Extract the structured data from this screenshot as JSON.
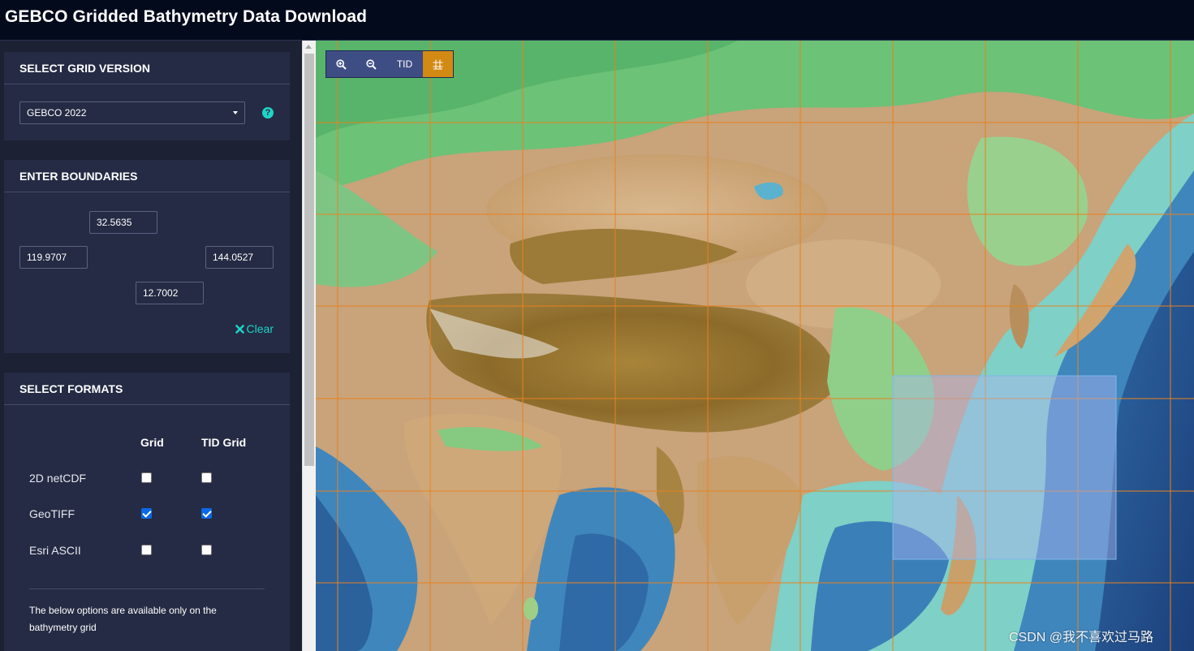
{
  "header": {
    "title": "GEBCO Gridded Bathymetry Data Download"
  },
  "grid_version": {
    "heading": "SELECT GRID VERSION",
    "selected": "GEBCO 2022",
    "help": "?"
  },
  "boundaries": {
    "heading": "ENTER BOUNDARIES",
    "north": "32.5635",
    "west": "119.9707",
    "east": "144.0527",
    "south": "12.7002",
    "clear_label": "Clear"
  },
  "formats": {
    "heading": "SELECT FORMATS",
    "col_grid": "Grid",
    "col_tid": "TID Grid",
    "rows": [
      {
        "label": "2D netCDF",
        "grid": false,
        "tid": false
      },
      {
        "label": "GeoTIFF",
        "grid": true,
        "tid": true
      },
      {
        "label": "Esri ASCII",
        "grid": false,
        "tid": false
      }
    ],
    "note": "The below options are available only on the bathymetry grid"
  },
  "map": {
    "toolbar": {
      "zoom_in": "zoom-in-icon",
      "zoom_out": "zoom-out-icon",
      "tid_label": "TID",
      "grid": "grid-icon"
    },
    "watermark": "CSDN @我不喜欢过马路",
    "colors": {
      "grid_lines": "#e8821e",
      "selection": "#aab4f0",
      "accent": "#1fd3c6"
    }
  }
}
